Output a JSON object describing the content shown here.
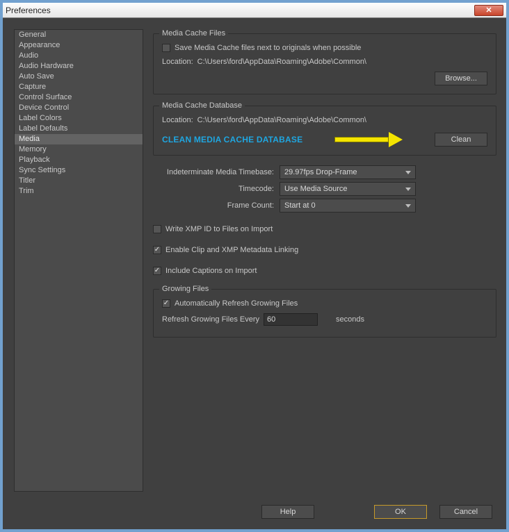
{
  "window": {
    "title": "Preferences"
  },
  "sidebar": {
    "items": [
      "General",
      "Appearance",
      "Audio",
      "Audio Hardware",
      "Auto Save",
      "Capture",
      "Control Surface",
      "Device Control",
      "Label Colors",
      "Label Defaults",
      "Media",
      "Memory",
      "Playback",
      "Sync Settings",
      "Titler",
      "Trim"
    ],
    "selected": "Media"
  },
  "cacheFiles": {
    "legend": "Media Cache Files",
    "saveNextLabel": "Save Media Cache files next to originals when possible",
    "saveNextChecked": false,
    "locationLabel": "Location:",
    "locationValue": "C:\\Users\\ford\\AppData\\Roaming\\Adobe\\Common\\",
    "browseLabel": "Browse..."
  },
  "cacheDb": {
    "legend": "Media Cache Database",
    "locationLabel": "Location:",
    "locationValue": "C:\\Users\\ford\\AppData\\Roaming\\Adobe\\Common\\",
    "calloutText": "CLEAN MEDIA CACHE DATABASE",
    "cleanLabel": "Clean"
  },
  "options": {
    "timebaseLabel": "Indeterminate Media Timebase:",
    "timebaseValue": "29.97fps Drop-Frame",
    "timecodeLabel": "Timecode:",
    "timecodeValue": "Use Media Source",
    "frameCountLabel": "Frame Count:",
    "frameCountValue": "Start at 0",
    "writeXmpLabel": "Write XMP ID to Files on Import",
    "writeXmpChecked": false,
    "enableClipXmpLabel": "Enable Clip and XMP Metadata Linking",
    "enableClipXmpChecked": true,
    "includeCaptionsLabel": "Include Captions on Import",
    "includeCaptionsChecked": true
  },
  "growing": {
    "legend": "Growing Files",
    "autoRefreshLabel": "Automatically Refresh Growing Files",
    "autoRefreshChecked": true,
    "everyLabel": "Refresh Growing Files Every",
    "everyValue": "60",
    "secondsLabel": "seconds"
  },
  "footer": {
    "help": "Help",
    "ok": "OK",
    "cancel": "Cancel"
  }
}
